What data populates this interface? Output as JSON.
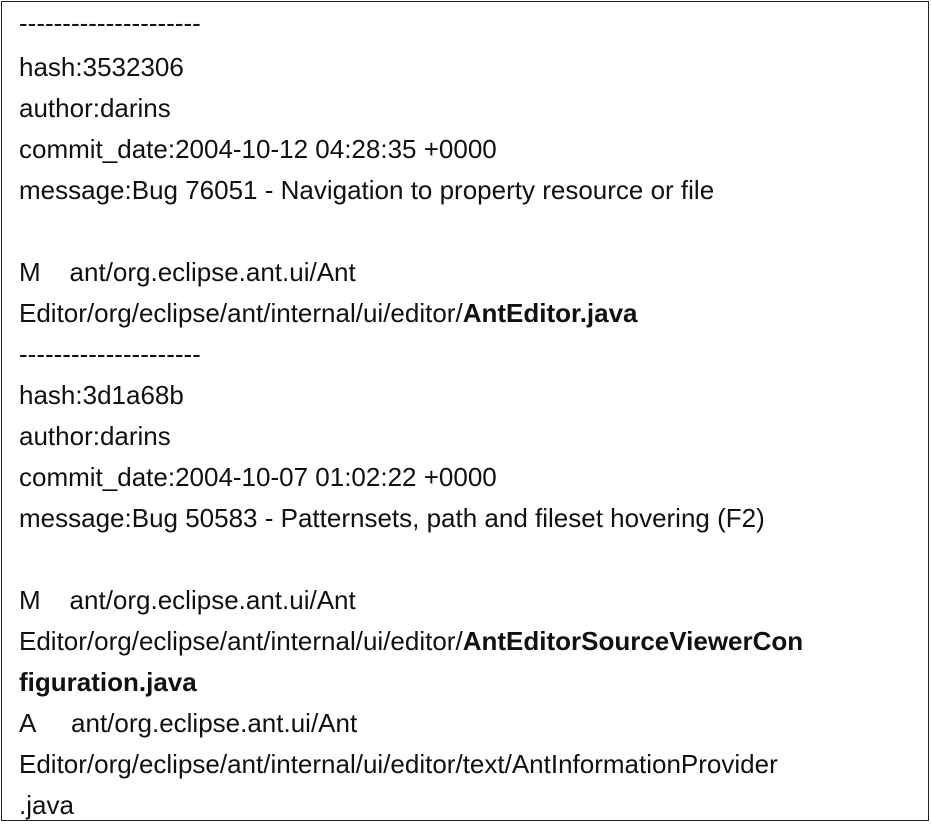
{
  "commits": [
    {
      "separator": "---------------------",
      "hash": "hash:3532306",
      "author": "author:darins",
      "commit_date": "commit_date:2004-10-12 04:28:35 +0000",
      "message": "message:Bug 76051 - Navigation to property resource or file",
      "files": [
        {
          "line1": "M    ant/org.eclipse.ant.ui/Ant",
          "line2_prefix": "Editor/org/eclipse/ant/internal/ui/editor/",
          "line2_bold": "AntEditor.java"
        }
      ]
    },
    {
      "separator": "---------------------",
      "hash": "hash:3d1a68b",
      "author": "author:darins",
      "commit_date": "commit_date:2004-10-07 01:02:22 +0000",
      "message": "message:Bug 50583 - Patternsets, path and fileset hovering (F2)",
      "files": [
        {
          "line1": "M    ant/org.eclipse.ant.ui/Ant",
          "line2_prefix": "Editor/org/eclipse/ant/internal/ui/editor/",
          "line2_bold": "AntEditorSourceViewerCon",
          "line3_bold": "figuration.java"
        },
        {
          "line1": "A     ant/org.eclipse.ant.ui/Ant",
          "line2": "Editor/org/eclipse/ant/internal/ui/editor/text/AntInformationProvider",
          "line3": ".java"
        }
      ]
    }
  ]
}
